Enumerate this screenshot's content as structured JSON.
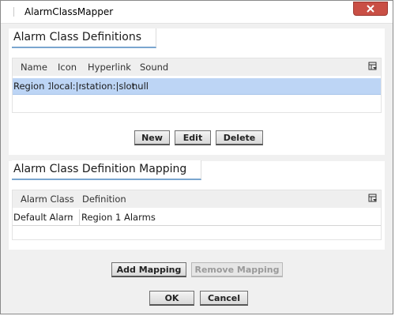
{
  "window": {
    "title": "AlarmClassMapper"
  },
  "definitions": {
    "title": "Alarm Class Definitions",
    "columns": [
      "Name",
      "Icon",
      "Hyperlink",
      "Sound"
    ],
    "rows": [
      {
        "name": "Region 1",
        "icon": "local:|r",
        "hyperlink": "station:|slot:",
        "sound": "null"
      }
    ],
    "buttons": {
      "new": "New",
      "edit": "Edit",
      "delete": "Delete"
    }
  },
  "mapping": {
    "title": "Alarm Class Definition Mapping",
    "columns": [
      "Alarm Class",
      "Definition"
    ],
    "rows": [
      {
        "alarm_class": "Default Alarm C",
        "definition": "Region 1 Alarms"
      }
    ],
    "buttons": {
      "add": "Add Mapping",
      "remove": "Remove Mapping"
    }
  },
  "footer": {
    "ok": "OK",
    "cancel": "Cancel"
  },
  "icons": {
    "close": "close-icon",
    "column_chooser": "column-chooser-icon"
  }
}
